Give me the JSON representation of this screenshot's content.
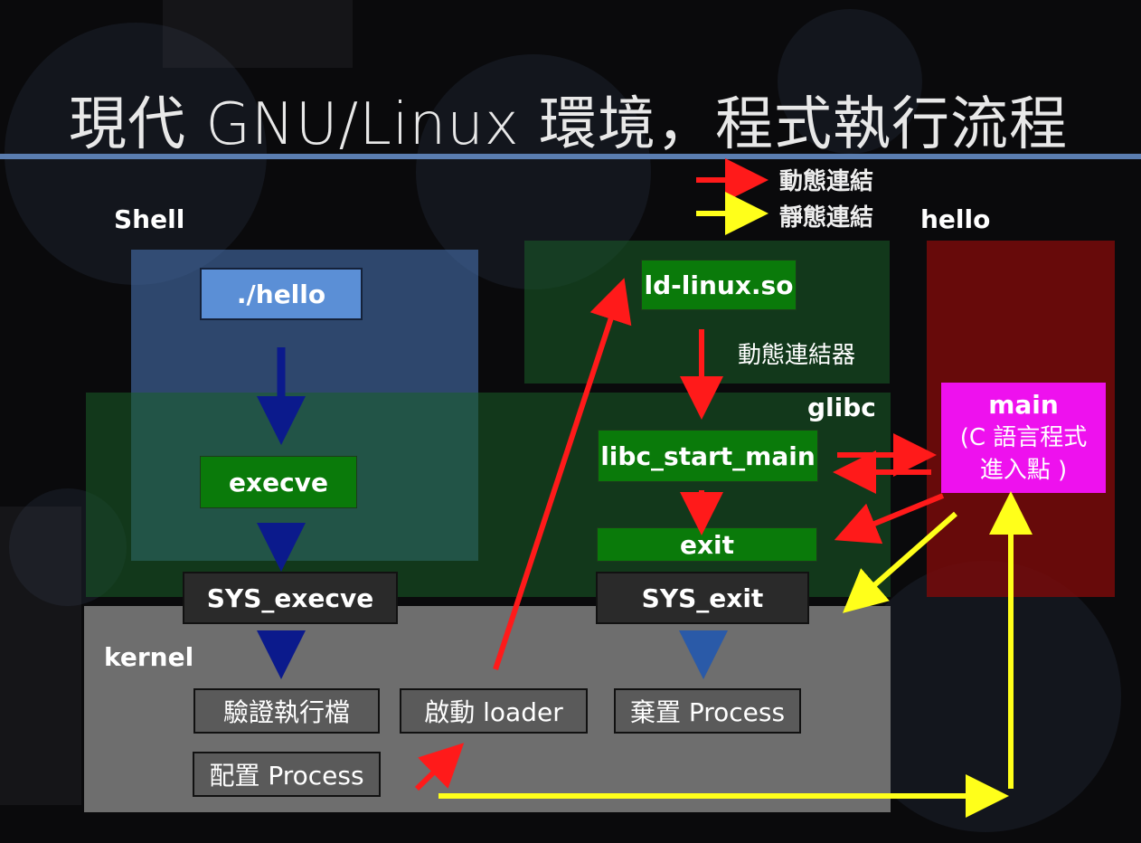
{
  "title": "現代 GNU/Linux 環境，程式執行流程",
  "legend": {
    "dynamic": "動態連結",
    "static": "靜態連結"
  },
  "colors": {
    "dynamic": "#ff1a1a",
    "static": "#ffff1a",
    "shell_flow": "#0b1a8c",
    "exit_flow": "#2a5aa8",
    "main": "#ee11ee"
  },
  "regions": {
    "shell": "Shell",
    "glibc": "glibc",
    "kernel": "kernel",
    "hello": "hello"
  },
  "nodes": {
    "hello_cmd": "./hello",
    "execve": "execve",
    "sys_execve": "SYS_execve",
    "ld_linux": "ld-linux.so",
    "dyn_linker": "動態連結器",
    "libc_start_main": "libc_start_main",
    "exit": "exit",
    "sys_exit": "SYS_exit",
    "main_title": "main",
    "main_sub1": "(C 語言程式",
    "main_sub2": "進入點 )",
    "verify_exec": "驗證執行檔",
    "start_loader": "啟動 loader",
    "discard_process": "棄置 Process",
    "alloc_process": "配置 Process"
  }
}
